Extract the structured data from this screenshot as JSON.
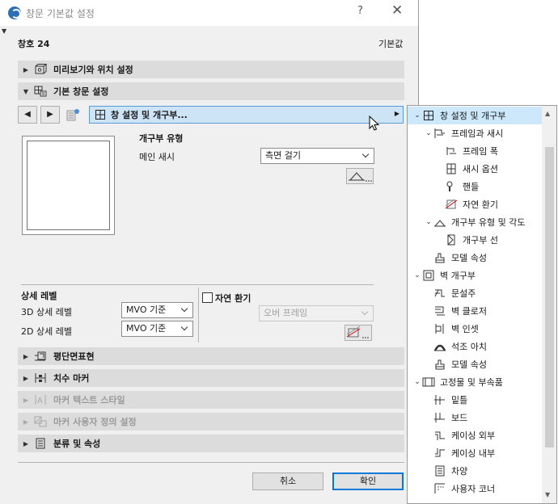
{
  "window": {
    "title": "창문 기본값 설정",
    "help": "?",
    "close": "✕"
  },
  "header": {
    "id_label": "창호 24",
    "default_label": "기본값"
  },
  "sections": {
    "preview": "미리보기와 위치 설정",
    "basic": "기본 창문 설정",
    "floorplan": "평단면표현",
    "dimension": "치수 마커",
    "marker_text": "마커 텍스트 스타일",
    "marker_custom": "마커 사용자 정의 설정",
    "classification": "분류 및 속성"
  },
  "nav": {
    "prev": "◀",
    "next": "▶",
    "dropdown_label": "창 설정 및 개구부...",
    "arrow": "▶"
  },
  "opening": {
    "title": "개구부 유형",
    "main_sash_label": "메인 새시",
    "main_sash_value": "측면 걸기"
  },
  "detail": {
    "title": "상세 레벨",
    "level3d_label": "3D 상세 레벨",
    "level3d_value": "MVO 기준",
    "level2d_label": "2D 상세 레벨",
    "level2d_value": "MVO 기준"
  },
  "natural_vent": {
    "label": "자연 환기",
    "checked": false,
    "value": "오버 프레임"
  },
  "buttons": {
    "cancel": "취소",
    "ok": "확인"
  },
  "menu": {
    "items": [
      {
        "label": "창 설정 및 개구부",
        "level": 0,
        "expanded": true,
        "selected": true,
        "icon": "frame-grid-icon"
      },
      {
        "label": "프레임과 새시",
        "level": 1,
        "expanded": true,
        "icon": "frame-sash-icon"
      },
      {
        "label": "프레임 폭",
        "level": 2,
        "icon": "frame-width-icon"
      },
      {
        "label": "새시 옵션",
        "level": 2,
        "icon": "sash-options-icon"
      },
      {
        "label": "핸들",
        "level": 2,
        "icon": "handle-icon"
      },
      {
        "label": "자연 환기",
        "level": 2,
        "icon": "natural-vent-icon"
      },
      {
        "label": "개구부 유형 및 각도",
        "level": 1,
        "expanded": true,
        "icon": "opening-angle-icon"
      },
      {
        "label": "개구부 선",
        "level": 2,
        "icon": "opening-line-icon"
      },
      {
        "label": "모델 속성",
        "level": 1,
        "icon": "model-attributes-icon"
      },
      {
        "label": "벽 개구부",
        "level": 0,
        "expanded": true,
        "icon": "wall-opening-icon"
      },
      {
        "label": "문설주",
        "level": 1,
        "icon": "jamb-icon"
      },
      {
        "label": "벽 클로저",
        "level": 1,
        "icon": "wall-closure-icon"
      },
      {
        "label": "벽 인셋",
        "level": 1,
        "icon": "wall-inset-icon"
      },
      {
        "label": "석조 아치",
        "level": 1,
        "icon": "masonry-arch-icon"
      },
      {
        "label": "모델 속성",
        "level": 1,
        "icon": "model-attributes-icon"
      },
      {
        "label": "고정물 및 부속품",
        "level": 0,
        "expanded": true,
        "icon": "fixtures-icon"
      },
      {
        "label": "밑틀",
        "level": 1,
        "icon": "sill-icon"
      },
      {
        "label": "보드",
        "level": 1,
        "icon": "board-icon"
      },
      {
        "label": "케이싱 외부",
        "level": 1,
        "icon": "casing-outside-icon"
      },
      {
        "label": "케이싱 내부",
        "level": 1,
        "icon": "casing-inside-icon"
      },
      {
        "label": "차양",
        "level": 1,
        "icon": "shade-icon"
      },
      {
        "label": "사용자 코너",
        "level": 1,
        "icon": "custom-corner-icon"
      }
    ]
  }
}
